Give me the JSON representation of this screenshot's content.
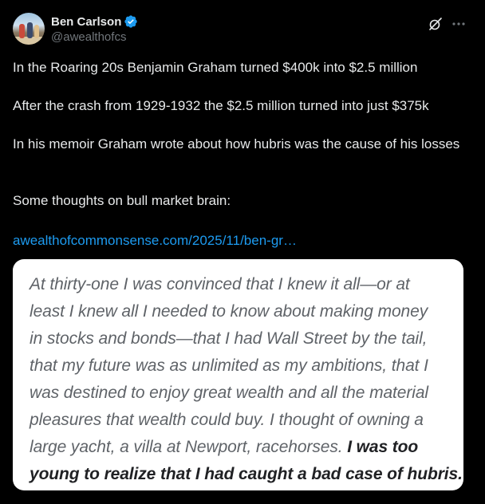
{
  "author": {
    "display_name": "Ben Carlson",
    "handle": "@awealthofcs",
    "verified": true,
    "avatar": "avatar-photo"
  },
  "header_icons": [
    "grok-icon",
    "more-icon"
  ],
  "post": {
    "paragraphs": [
      "In the Roaring 20s Benjamin Graham turned $400k into $2.5 million",
      "After the crash from 1929-1932 the $2.5 million turned into just $375k",
      "In his memoir Graham wrote about how hubris was the cause of his losses",
      "Some thoughts on bull market brain:"
    ],
    "link": "awealthofcommonsense.com/2025/11/ben-gr…"
  },
  "quote_image": {
    "lines": [
      "At thirty-one I was convinced that I knew it all—or at",
      "least I knew all I needed to know about making money",
      "in stocks and bonds—that I had Wall Street by the tail,",
      "that my future was as unlimited as my ambitions, that I",
      "was destined to enjoy great wealth and all the material",
      "pleasures that wealth could buy. I thought of owning a"
    ],
    "line7_regular": "large yacht, a villa at Newport, racehorses. ",
    "line7_bold": "I was too",
    "line8_bold": "young to realize that I had caught a bad case of hubris."
  },
  "colors": {
    "background": "#000000",
    "text": "#e7e9ea",
    "secondary": "#71767b",
    "link": "#1d9bf0",
    "verified": "#1d9bf0"
  }
}
